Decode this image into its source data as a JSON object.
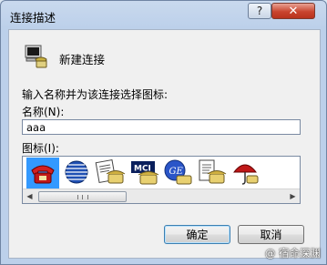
{
  "window": {
    "title": "连接描述",
    "help_label": "?",
    "close_label": "✕"
  },
  "header": {
    "icon": "phone-computer-icon",
    "label": "新建连接"
  },
  "form": {
    "prompt": "输入名称并为该连接选择图标:",
    "name_label": "名称(N):",
    "name_value": "aaa",
    "icon_label": "图标(I):"
  },
  "icons": [
    {
      "name": "red-phone-icon",
      "selected": true
    },
    {
      "name": "globe-icon",
      "selected": false
    },
    {
      "name": "phone-newspaper-icon",
      "selected": false
    },
    {
      "name": "mci-phone-icon",
      "selected": false
    },
    {
      "name": "ge-phone-icon",
      "selected": false
    },
    {
      "name": "phone-document-icon",
      "selected": false
    },
    {
      "name": "umbrella-icon",
      "selected": false
    }
  ],
  "buttons": {
    "ok": "确定",
    "cancel": "取消"
  },
  "watermark": "@ 宿命深渊",
  "colors": {
    "selection": "#3399ff",
    "close_button": "#c9452f",
    "title_bar": "#c9d9ee"
  }
}
